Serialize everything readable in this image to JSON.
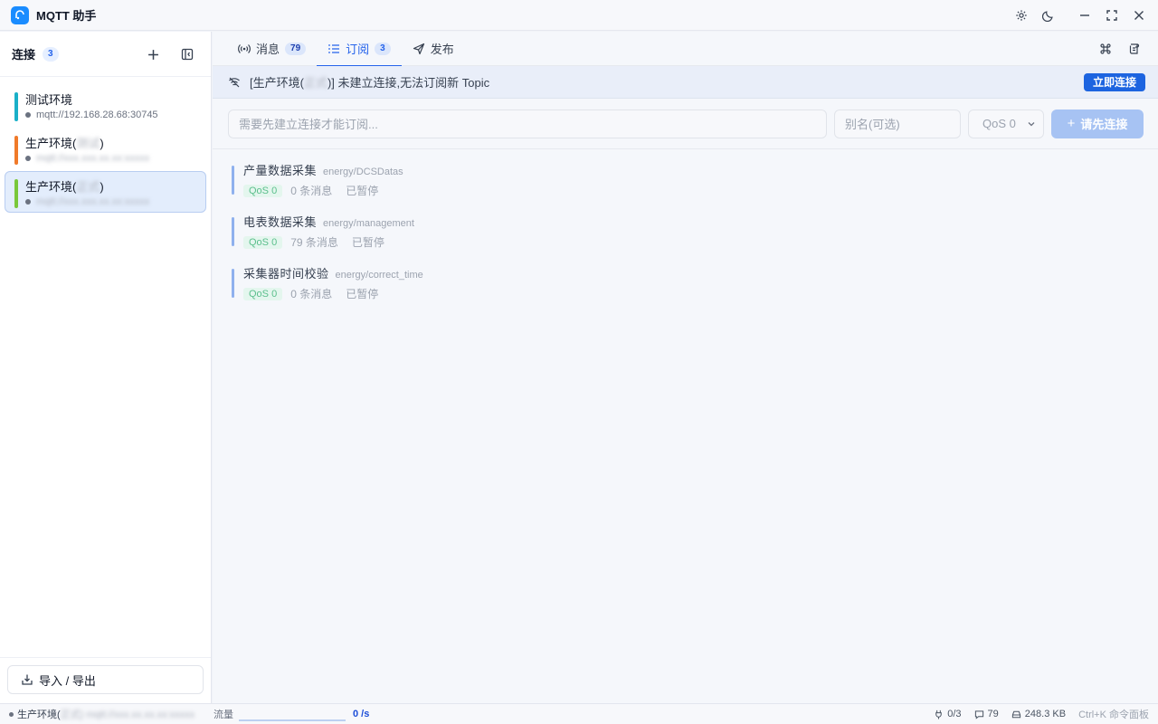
{
  "app": {
    "title": "MQTT 助手"
  },
  "sidebar": {
    "title": "连接",
    "count": "3",
    "connections": [
      {
        "name": "测试环境",
        "url": "mqtt://192.168.28.68:30745",
        "color": "#1ab0c8"
      },
      {
        "name": "生产环境(",
        "name_blur": "测试",
        "name_suffix": ")",
        "url": "mqtt://xxx.xxx.xx.xx:xxxxx",
        "color": "#f07a2a"
      },
      {
        "name": "生产环境(",
        "name_blur": "正式",
        "name_suffix": ")",
        "url": "mqtt://xxx.xxx.xx.xx:xxxxx",
        "color": "#79c83a"
      }
    ],
    "import_export_label": "导入 / 导出"
  },
  "tabs": [
    {
      "label": "消息",
      "badge": "79"
    },
    {
      "label": "订阅",
      "badge": "3"
    },
    {
      "label": "发布"
    }
  ],
  "warning": {
    "prefix": "[生产环境(",
    "blur": "正式",
    "text": ")] 未建立连接,无法订阅新 Topic",
    "button": "立即连接"
  },
  "form": {
    "topic_placeholder": "需要先建立连接才能订阅...",
    "alias_placeholder": "别名(可选)",
    "qos_value": "QoS 0",
    "submit_label": "请先连接"
  },
  "subscriptions": [
    {
      "name": "产量数据采集",
      "topic": "energy/DCSDatas",
      "qos": "QoS 0",
      "count": "0 条消息",
      "status": "已暂停"
    },
    {
      "name": "电表数据采集",
      "topic": "energy/management",
      "qos": "QoS 0",
      "count": "79 条消息",
      "status": "已暂停"
    },
    {
      "name": "采集器时间校验",
      "topic": "energy/correct_time",
      "qos": "QoS 0",
      "count": "0 条消息",
      "status": "已暂停"
    }
  ],
  "statusbar": {
    "conn_name": "生产环境(",
    "conn_blur": "正式)   mqtt://xxx.xx.xx.xx:xxxxx",
    "traffic_label": "流量",
    "traffic_rate": "0 /s",
    "subs": "0/3",
    "messages": "79",
    "size": "248.3 KB",
    "hint": "Ctrl+K 命令面板"
  }
}
